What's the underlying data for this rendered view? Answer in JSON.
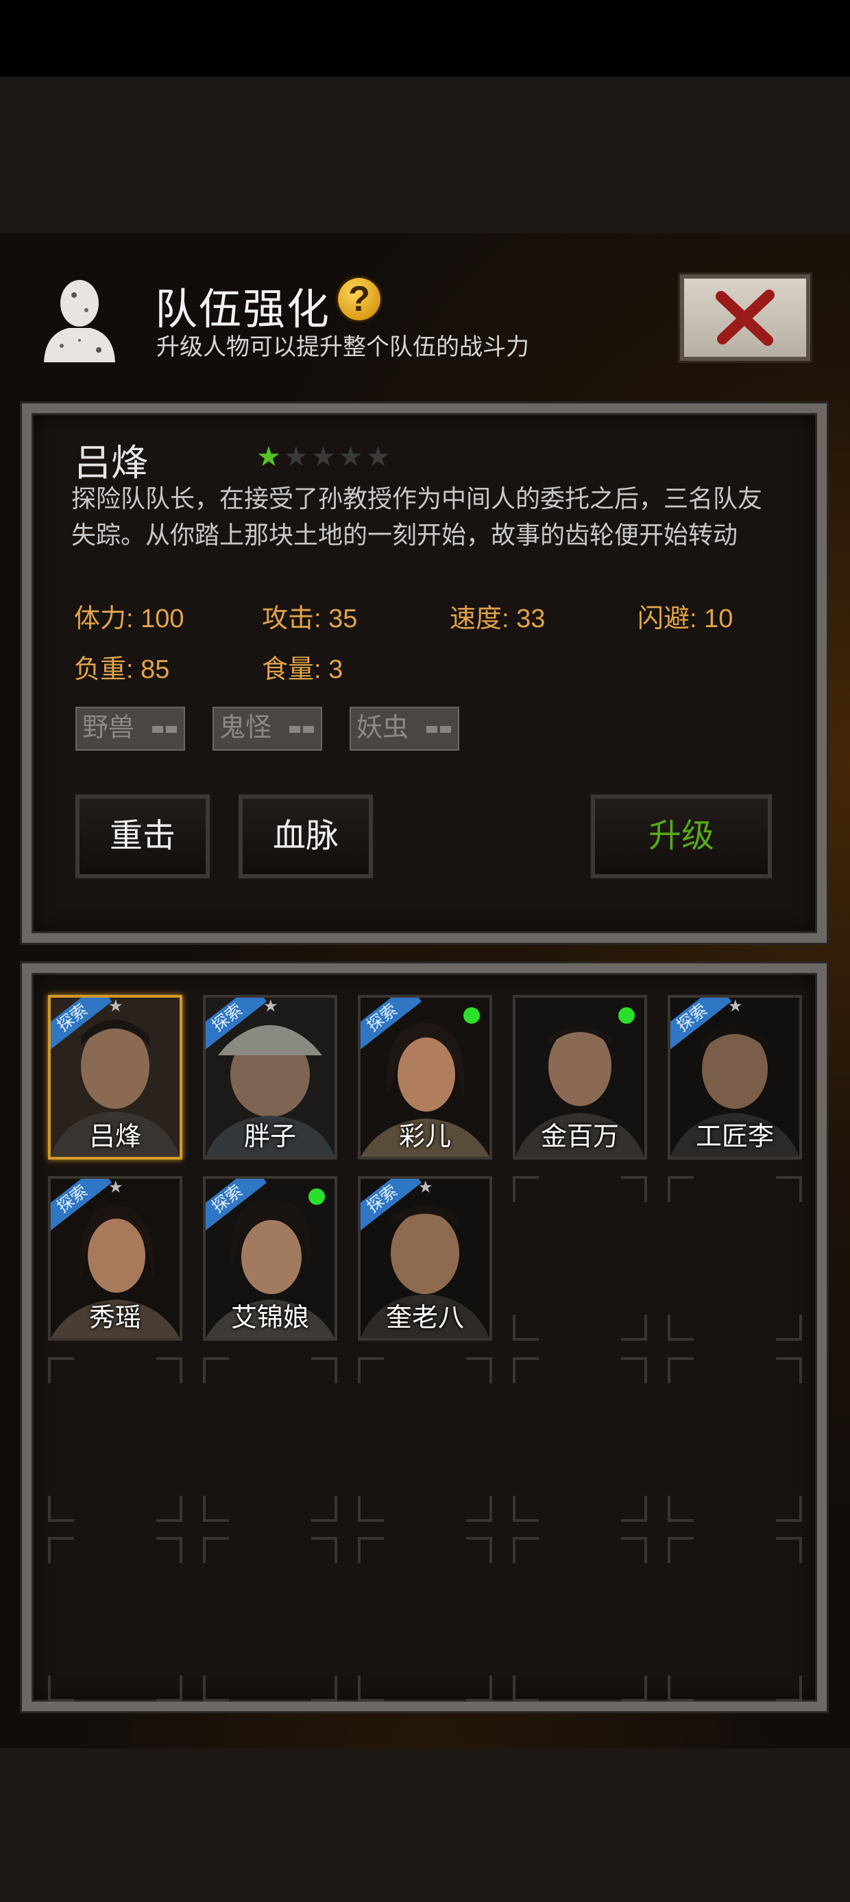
{
  "header": {
    "title": "队伍强化",
    "help_icon": "?",
    "subtitle": "升级人物可以提升整个队伍的战斗力"
  },
  "character": {
    "name": "吕烽",
    "star_rating": 1,
    "star_max": 5,
    "description": "探险队队长，在接受了孙教授作为中间人的委托之后，三名队友失踪。从你踏上那块土地的一刻开始，故事的齿轮便开始转动",
    "stats": [
      {
        "label": "体力: 100"
      },
      {
        "label": "攻击: 35"
      },
      {
        "label": "速度: 33"
      },
      {
        "label": "闪避: 10"
      },
      {
        "label": "负重: 85"
      },
      {
        "label": "食量: 3"
      }
    ],
    "tags": [
      "野兽",
      "鬼怪",
      "妖虫"
    ]
  },
  "buttons": {
    "skill1": "重击",
    "skill2": "血脉",
    "upgrade": "升级"
  },
  "roster": {
    "ribbon_text": "探索",
    "members": [
      {
        "name": "吕烽",
        "ribbon": true,
        "online": false,
        "selected": true
      },
      {
        "name": "胖子",
        "ribbon": true,
        "online": false,
        "selected": false
      },
      {
        "name": "彩儿",
        "ribbon": true,
        "online": true,
        "selected": false
      },
      {
        "name": "金百万",
        "ribbon": false,
        "online": true,
        "selected": false
      },
      {
        "name": "工匠李",
        "ribbon": true,
        "online": false,
        "selected": false
      },
      {
        "name": "秀瑶",
        "ribbon": true,
        "online": false,
        "selected": false
      },
      {
        "name": "艾锦娘",
        "ribbon": true,
        "online": true,
        "selected": false
      },
      {
        "name": "奎老八",
        "ribbon": true,
        "online": false,
        "selected": false
      }
    ]
  },
  "colors": {
    "stat_text": "#e0a44a",
    "upgrade_text": "#5aa81a",
    "star_on": "#57c02c",
    "ribbon": "#2f76c4",
    "online": "#2ae02a",
    "selected_border": "#d39a2a"
  }
}
